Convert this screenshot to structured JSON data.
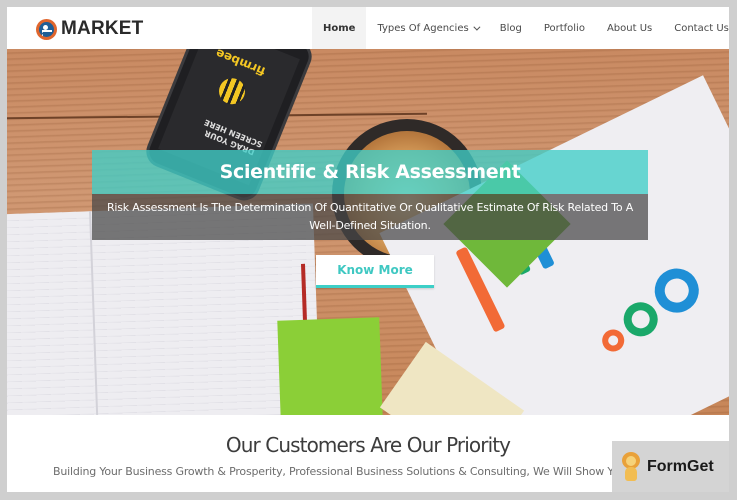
{
  "header": {
    "logo_text": "MARKET",
    "nav": [
      {
        "label": "Home",
        "active": true
      },
      {
        "label": "Types Of Agencies",
        "has_dropdown": true
      },
      {
        "label": "Blog"
      },
      {
        "label": "Portfolio"
      },
      {
        "label": "About Us"
      },
      {
        "label": "Contact Us"
      }
    ]
  },
  "hero": {
    "title": "Scientific & Risk Assessment",
    "description": "Risk Assessment Is The Determination Of Quantitative Or Qualitative Estimate Of Risk Related To A Well-Defined Situation.",
    "cta_label": "Know More",
    "phone_brand": "firmbee",
    "phone_text": "DRAG YOUR SCREEN HERE",
    "accent_color": "#3fc8c2"
  },
  "section": {
    "title": "Our Customers Are Our Priority",
    "subtitle": "Building Your Business Growth & Prosperity, Professional Business Solutions & Consulting, We Will Show Yo"
  },
  "watermark": {
    "label": "FormGet"
  }
}
